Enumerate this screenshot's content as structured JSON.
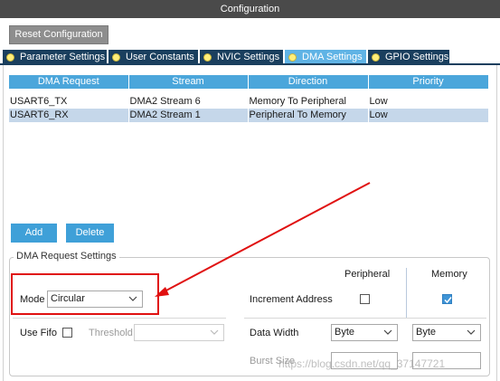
{
  "window": {
    "title": "Configuration"
  },
  "toolbar": {
    "reset_label": "Reset Configuration"
  },
  "tabs": [
    {
      "label": "Parameter Settings",
      "active": false
    },
    {
      "label": "User Constants",
      "active": false
    },
    {
      "label": "NVIC Settings",
      "active": false
    },
    {
      "label": "DMA Settings",
      "active": true
    },
    {
      "label": "GPIO Settings",
      "active": false
    }
  ],
  "dma_table": {
    "columns": [
      "DMA Request",
      "Stream",
      "Direction",
      "Priority"
    ],
    "rows": [
      {
        "request": "USART6_TX",
        "stream": "DMA2 Stream 6",
        "direction": "Memory To Peripheral",
        "priority": "Low",
        "selected": false
      },
      {
        "request": "USART6_RX",
        "stream": "DMA2 Stream 1",
        "direction": "Peripheral To Memory",
        "priority": "Low",
        "selected": true
      }
    ]
  },
  "buttons": {
    "add": "Add",
    "delete": "Delete"
  },
  "settings": {
    "title": "DMA Request Settings",
    "mode_label": "Mode",
    "mode_value": "Circular",
    "use_fifo_label": "Use Fifo",
    "threshold_label": "Threshold",
    "threshold_value": "",
    "peripheral_header": "Peripheral",
    "memory_header": "Memory",
    "increment_address_label": "Increment Address",
    "peripheral_increment": false,
    "memory_increment": true,
    "data_width_label": "Data Width",
    "peripheral_data_width": "Byte",
    "memory_data_width": "Byte",
    "burst_size_label": "Burst Size"
  },
  "watermark": "https://blog.csdn.net/qq_37147721",
  "colors": {
    "accent": "#4ba6db",
    "tab_bg": "#1a3f5e",
    "tab_active": "#5fb3e5",
    "selected_row": "#c5d7ea",
    "annotation": "#e01010"
  }
}
